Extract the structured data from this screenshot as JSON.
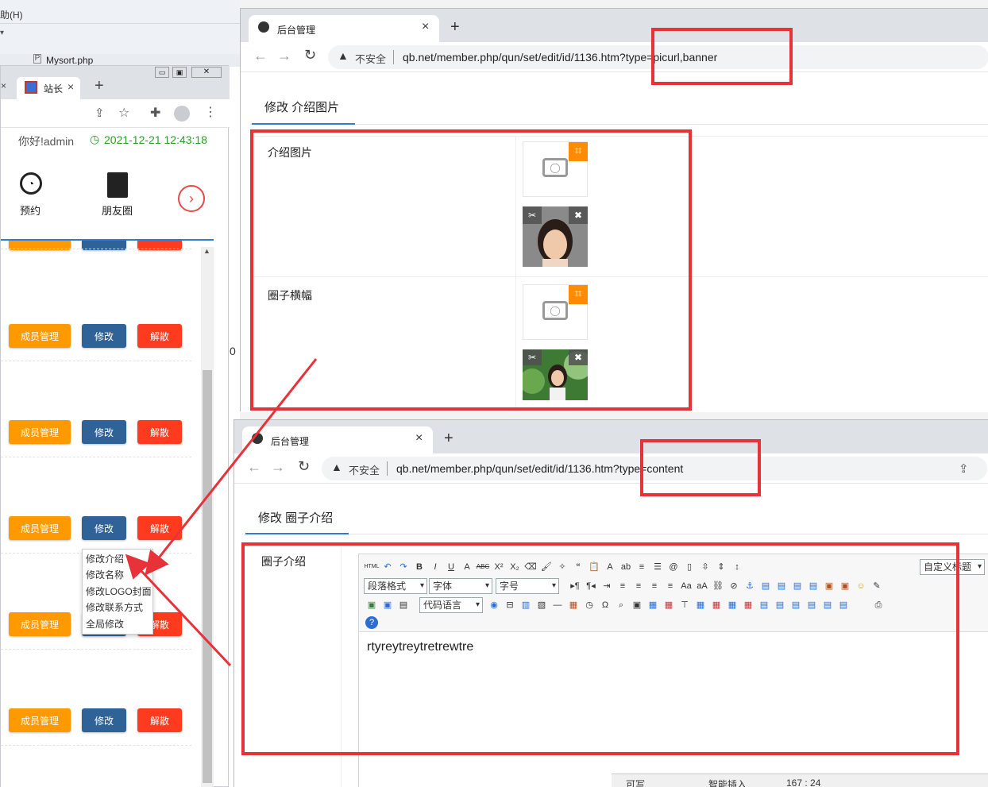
{
  "left_window": {
    "menu_help": "助(H)",
    "file_tab": "Mysort.php",
    "browser_tab_title": "站长",
    "greeting": "你好!admin",
    "datetime": "2021-12-21 12:43:18",
    "nav": [
      {
        "label": "预约"
      },
      {
        "label": "朋友圈"
      }
    ],
    "rows": [
      {
        "manage": "成员管理",
        "edit": "修改",
        "dissolve": "解散"
      },
      {
        "manage": "成员管理",
        "edit": "修改",
        "dissolve": "解散"
      },
      {
        "manage": "成员管理",
        "edit": "修改",
        "dissolve": "解散"
      },
      {
        "manage": "成员管理",
        "edit": "修改",
        "dissolve": "解散"
      },
      {
        "manage": "成员管理",
        "edit": "修改",
        "dissolve": "解散"
      }
    ],
    "dropdown": [
      "修改介绍",
      "修改名称",
      "修改LOGO封面",
      "修改联系方式",
      "全局修改"
    ]
  },
  "top_window": {
    "tab_title": "后台管理",
    "not_secure": "不安全",
    "url": "qb.net/member.php/qun/set/edit/id/1136.htm?type=picurl,banner",
    "panel_title": "修改 介绍图片",
    "fields": [
      {
        "label": "介绍图片"
      },
      {
        "label": "圈子横幅"
      }
    ]
  },
  "bottom_window": {
    "tab_title": "后台管理",
    "not_secure": "不安全",
    "url": "qb.net/member.php/qun/set/edit/id/1136.htm?type=content",
    "panel_title": "修改 圈子介绍",
    "field_label": "圈子介绍",
    "editor": {
      "custom_title": "自定义标题",
      "paragraph_format": "段落格式",
      "font": "字体",
      "font_size": "字号",
      "code_language": "代码语言",
      "content": "rtyreytreytretrewtre"
    },
    "status": {
      "writable": "可写",
      "mode": "智能插入",
      "pos": "167 : 24"
    }
  },
  "colors": {
    "accent_red": "#e8323a",
    "orange": "#ff9900",
    "blue": "#2f6296",
    "danger": "#ff3b1f",
    "crop": "#ff8c00"
  }
}
